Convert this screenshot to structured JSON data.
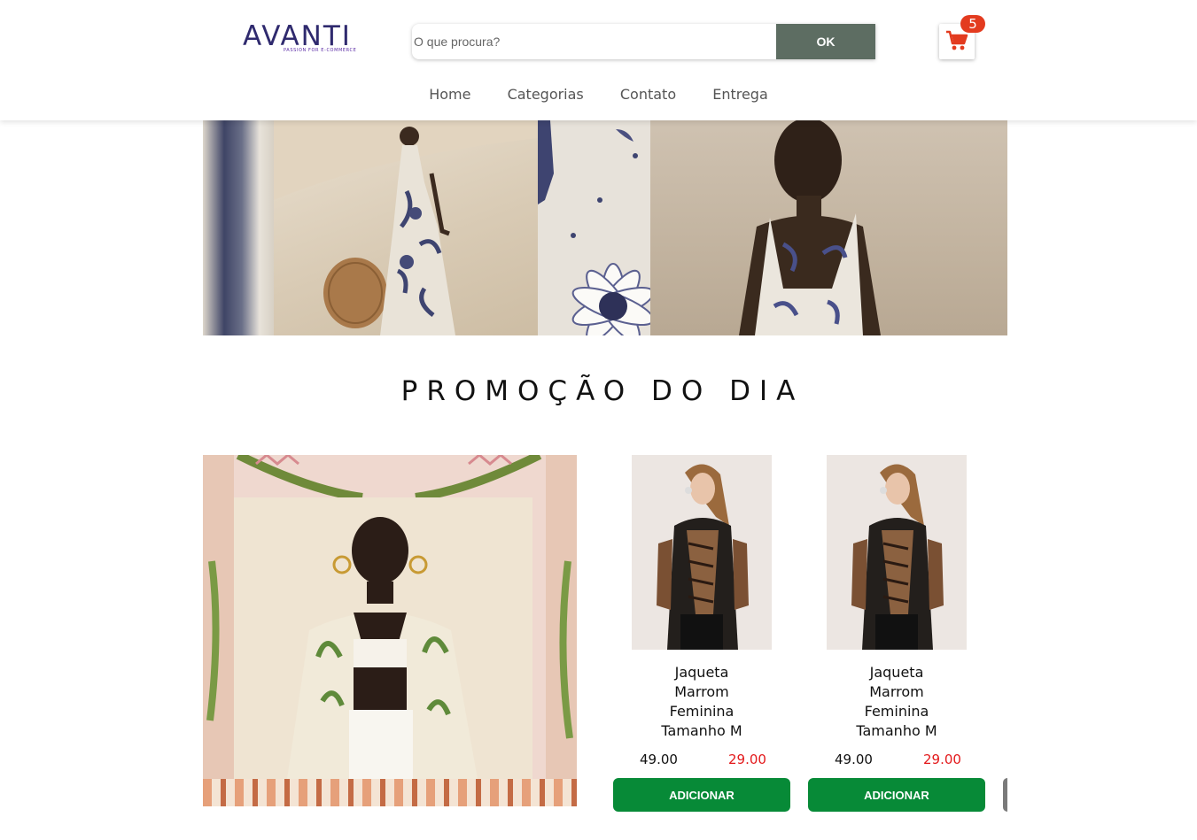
{
  "header": {
    "logo": {
      "word": "AVANTI",
      "tagline": "PASSION FOR E-COMMERCE"
    },
    "search": {
      "placeholder": "O que procura?",
      "value": "",
      "button_label": "OK"
    },
    "cart": {
      "icon": "shopping-cart-icon",
      "count": "5",
      "icon_color": "#e33b1f"
    }
  },
  "nav": {
    "items": [
      {
        "label": "Home"
      },
      {
        "label": "Categorias"
      },
      {
        "label": "Contato"
      },
      {
        "label": "Entrega"
      }
    ]
  },
  "promo": {
    "title": "PROMOÇÃO DO DIA",
    "products": [
      {
        "name": "Jaqueta Marrom Feminina Tamanho M",
        "old_price": "49.00",
        "price": "29.00",
        "button_label": "ADICIONAR"
      },
      {
        "name": "Jaqueta Marrom Feminina Tamanho M",
        "old_price": "49.00",
        "price": "29.00",
        "button_label": "ADICIONAR"
      }
    ]
  },
  "colors": {
    "search_button": "#5d6d62",
    "add_button": "#078a37",
    "sale_price": "#e3191b",
    "badge": "#e33b1f"
  }
}
